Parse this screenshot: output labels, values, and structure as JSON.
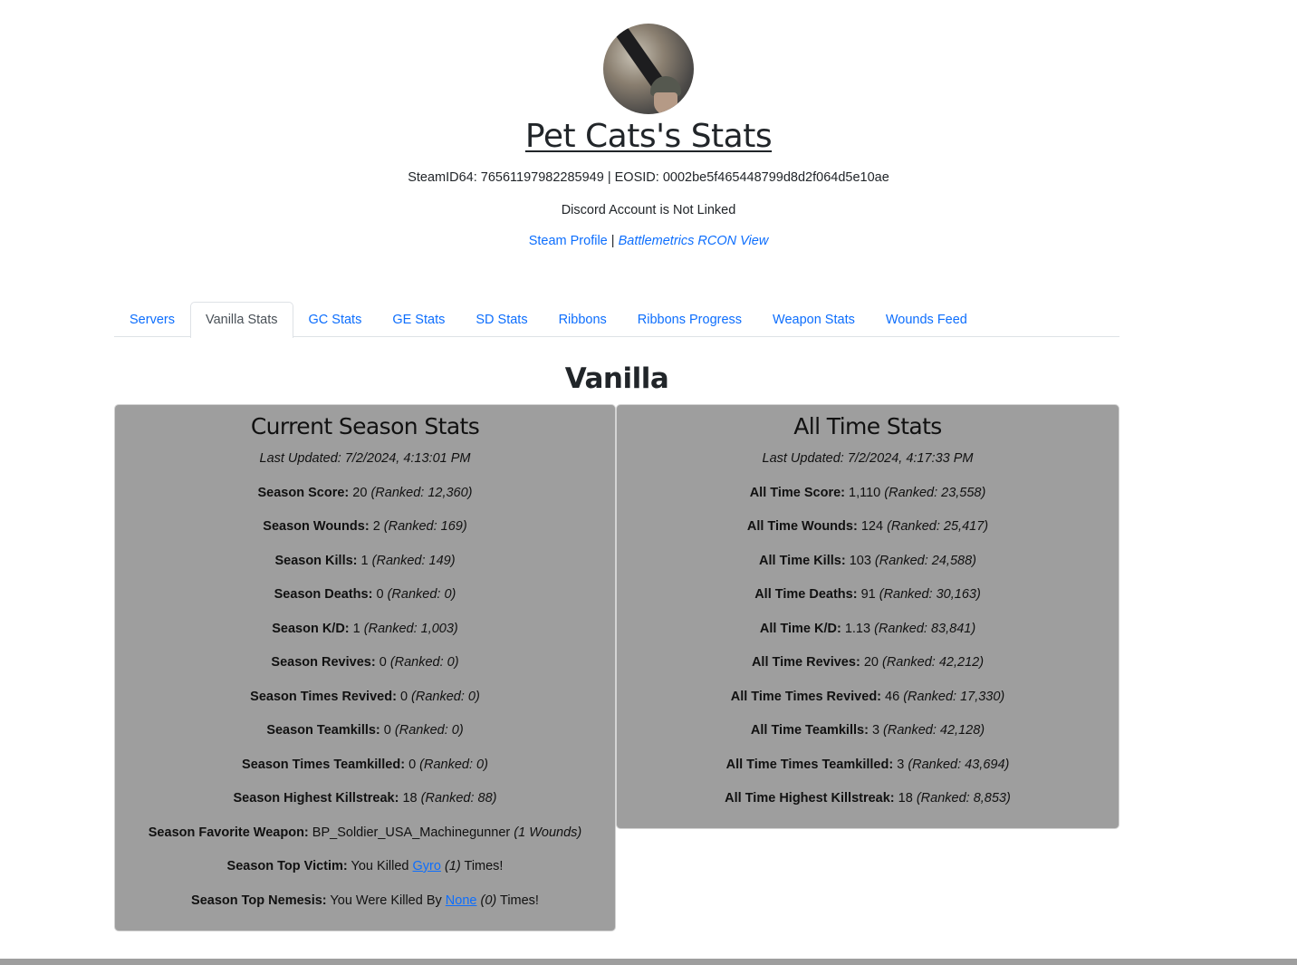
{
  "header": {
    "avatar_alt": "Player avatar",
    "title": "Pet Cats's Stats",
    "ids_line": "SteamID64: 76561197982285949 | EOSID: 0002be5f465448799d8d2f064d5e10ae",
    "discord_status": "Discord Account is Not Linked",
    "steam_profile_label": "Steam Profile",
    "separator": " | ",
    "battlemetrics_label": "Battlemetrics RCON View"
  },
  "tabs": [
    {
      "label": "Servers",
      "active": false
    },
    {
      "label": "Vanilla Stats",
      "active": true
    },
    {
      "label": "GC Stats",
      "active": false
    },
    {
      "label": "GE Stats",
      "active": false
    },
    {
      "label": "SD Stats",
      "active": false
    },
    {
      "label": "Ribbons",
      "active": false
    },
    {
      "label": "Ribbons Progress",
      "active": false
    },
    {
      "label": "Weapon Stats",
      "active": false
    },
    {
      "label": "Wounds Feed",
      "active": false
    }
  ],
  "section_title": "Vanilla",
  "season": {
    "title": "Current Season Stats",
    "last_updated": "Last Updated: 7/2/2024, 4:13:01 PM",
    "stats": [
      {
        "label": "Season Score:",
        "value": "20",
        "rank": "(Ranked: 12,360)"
      },
      {
        "label": "Season Wounds:",
        "value": "2",
        "rank": "(Ranked: 169)"
      },
      {
        "label": "Season Kills:",
        "value": "1",
        "rank": "(Ranked: 149)"
      },
      {
        "label": "Season Deaths:",
        "value": "0",
        "rank": "(Ranked: 0)"
      },
      {
        "label": "Season K/D:",
        "value": "1",
        "rank": "(Ranked: 1,003)"
      },
      {
        "label": "Season Revives:",
        "value": "0",
        "rank": "(Ranked: 0)"
      },
      {
        "label": "Season Times Revived:",
        "value": "0",
        "rank": "(Ranked: 0)"
      },
      {
        "label": "Season Teamkills:",
        "value": "0",
        "rank": "(Ranked: 0)"
      },
      {
        "label": "Season Times Teamkilled:",
        "value": "0",
        "rank": "(Ranked: 0)"
      },
      {
        "label": "Season Highest Killstreak:",
        "value": "18",
        "rank": "(Ranked: 88)"
      },
      {
        "label": "Season Favorite Weapon:",
        "value": "BP_Soldier_USA_Machinegunner",
        "rank": "(1 Wounds)"
      }
    ],
    "top_victim": {
      "label": "Season Top Victim:",
      "prefix": "You Killed",
      "name": "Gyro",
      "count": "(1)",
      "suffix": "Times!"
    },
    "top_nemesis": {
      "label": "Season Top Nemesis:",
      "prefix": "You Were Killed By",
      "name": "None",
      "count": "(0)",
      "suffix": "Times!"
    }
  },
  "alltime": {
    "title": "All Time Stats",
    "last_updated": "Last Updated: 7/2/2024, 4:17:33 PM",
    "stats": [
      {
        "label": "All Time Score:",
        "value": "1,110",
        "rank": "(Ranked: 23,558)"
      },
      {
        "label": "All Time Wounds:",
        "value": "124",
        "rank": "(Ranked: 25,417)"
      },
      {
        "label": "All Time Kills:",
        "value": "103",
        "rank": "(Ranked: 24,588)"
      },
      {
        "label": "All Time Deaths:",
        "value": "91",
        "rank": "(Ranked: 30,163)"
      },
      {
        "label": "All Time K/D:",
        "value": "1.13",
        "rank": "(Ranked: 83,841)"
      },
      {
        "label": "All Time Revives:",
        "value": "20",
        "rank": "(Ranked: 42,212)"
      },
      {
        "label": "All Time Times Revived:",
        "value": "46",
        "rank": "(Ranked: 17,330)"
      },
      {
        "label": "All Time Teamkills:",
        "value": "3",
        "rank": "(Ranked: 42,128)"
      },
      {
        "label": "All Time Times Teamkilled:",
        "value": "3",
        "rank": "(Ranked: 43,694)"
      },
      {
        "label": "All Time Highest Killstreak:",
        "value": "18",
        "rank": "(Ranked: 8,853)"
      }
    ]
  },
  "colors": {
    "link": "#0d6efd",
    "card_bg": "#9e9e9e",
    "text": "#212529"
  }
}
